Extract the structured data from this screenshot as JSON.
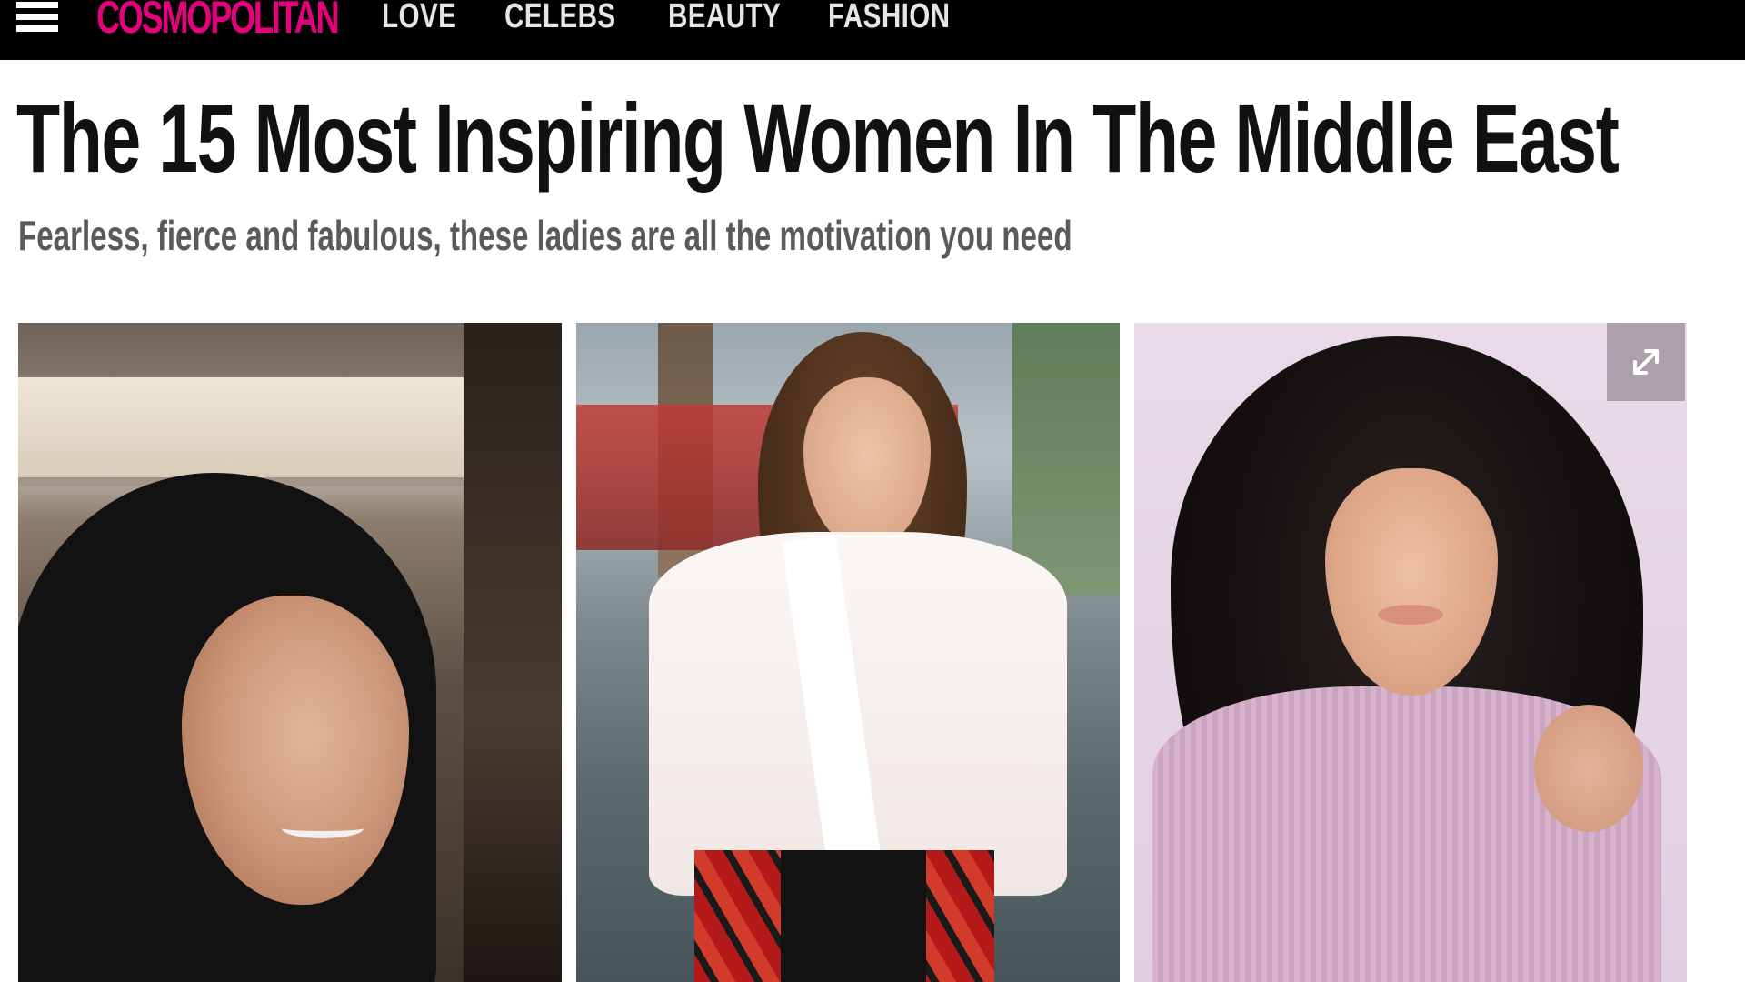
{
  "header": {
    "logo_text": "COSMOPOLITAN",
    "logo_color": "#e5007e",
    "nav": [
      {
        "label": "LOVE"
      },
      {
        "label": "CELEBS"
      },
      {
        "label": "BEAUTY"
      },
      {
        "label": "FASHION"
      }
    ],
    "menu_icon": "hamburger-menu-icon",
    "background": "#000000"
  },
  "article": {
    "title": "The 15 Most Inspiring Women In The Middle East",
    "subtitle": "Fearless, fierce and fabulous, these ladies are all the motivation you need"
  },
  "gallery": {
    "images": [
      {
        "name": "gallery-image-1"
      },
      {
        "name": "gallery-image-2"
      },
      {
        "name": "gallery-image-3"
      }
    ],
    "expand_icon": "expand-icon"
  }
}
